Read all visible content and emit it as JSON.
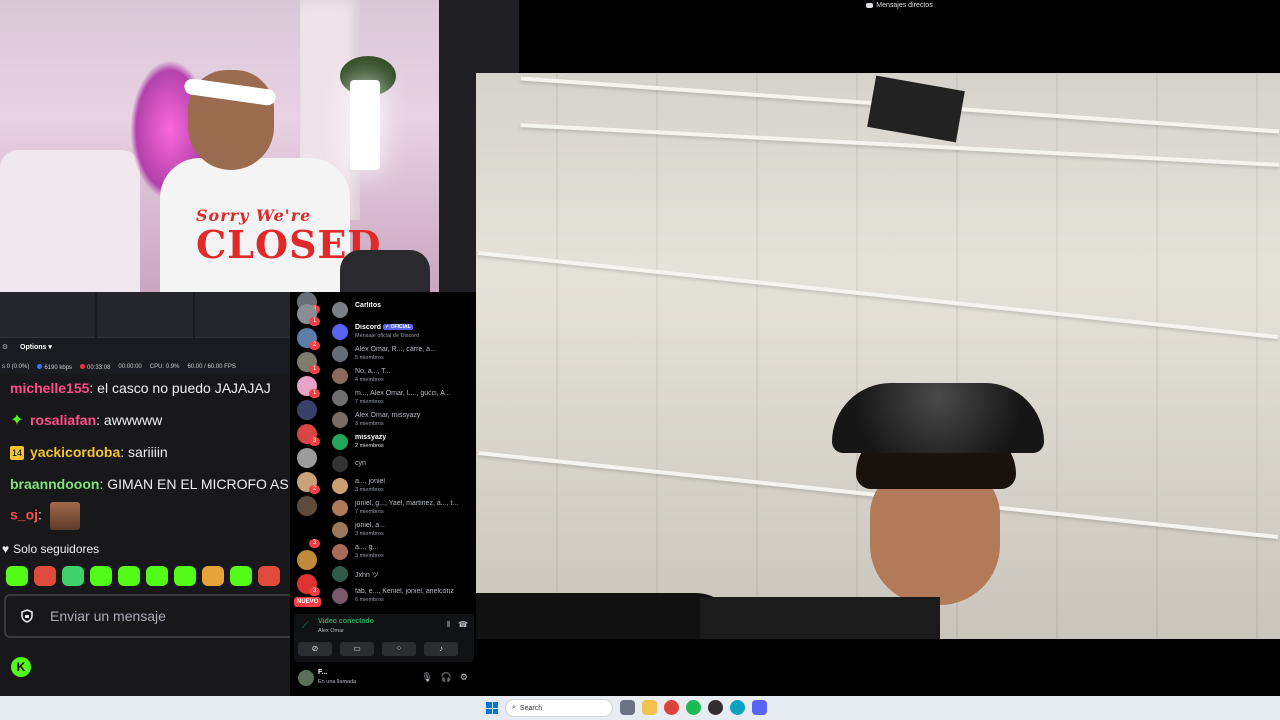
{
  "video_window": {
    "title": "Mensajes directos"
  },
  "webcam": {
    "shirt_line1": "Sorry We're",
    "shirt_line2": "CLOSED"
  },
  "obs": {
    "options_label": "Options",
    "stats": [
      "s 0 (0.0%)",
      "6190 kbps",
      "00:33:08",
      "00:00:00",
      "CPU: 0.9%",
      "60.00 / 60.00 FPS"
    ]
  },
  "chat": {
    "messages": [
      {
        "user": "michelle155",
        "text": "el casco no puedo JAJAJAJ",
        "color": "#ff4f87"
      },
      {
        "user": "rosaliafan",
        "text": "awwwww",
        "color": "#ff4f87",
        "badge": "sparkle"
      },
      {
        "user": "yackicordoba",
        "text": "sariiiin",
        "color": "#f4c430",
        "badge": "14"
      },
      {
        "user": "braanndooon",
        "text": "GIMAN EN EL MICROFO ASI",
        "color": "#7fe27a"
      },
      {
        "user": "s_oj",
        "text": "",
        "color": "#ff4f4f"
      }
    ],
    "followers_only": "Solo seguidores",
    "input_placeholder": "Enviar un mensaje",
    "kick_logo": "K",
    "emote_colors": [
      "#53fc18",
      "#e04a3a",
      "#3fd26b",
      "#53fc18",
      "#53fc18",
      "#53fc18",
      "#53fc18",
      "#e8a23a",
      "#53fc18",
      "#e04a3a"
    ]
  },
  "discord": {
    "guild_badges": [
      "6",
      "1",
      "2",
      "1",
      "1",
      "",
      "3",
      "",
      "2",
      "",
      "3",
      "",
      "3",
      "12",
      "",
      ""
    ],
    "nuevo_label": "NUEVO",
    "dms": [
      {
        "name": "Carlitos",
        "sub": "",
        "bold": true
      },
      {
        "name": "Discord",
        "official": "✓ OFICIAL",
        "sub": "Mensaje oficial de Discord",
        "bold": true
      },
      {
        "name": "Alex Omar, R..., carre, a...",
        "sub": "5 miembros"
      },
      {
        "name": "No, a..., T...",
        "sub": "4 miembros"
      },
      {
        "name": "m..., Alex Omar, L..., gucci, A...",
        "sub": "7 miembros"
      },
      {
        "name": "Alex Omar, missyazy",
        "sub": "3 miembros"
      },
      {
        "name": "missyazy",
        "sub": "2 miembros",
        "bold": true
      },
      {
        "name": "cyn",
        "sub": ""
      },
      {
        "name": "a..., joniel",
        "sub": "3 miembros"
      },
      {
        "name": "joniel, g..., Yael, martinez, a..., t...",
        "sub": "7 miembros"
      },
      {
        "name": "joniel, a...",
        "sub": "3 miembros"
      },
      {
        "name": "a..., g...",
        "sub": "3 miembros"
      },
      {
        "name": "Jxhn ツ",
        "sub": ""
      },
      {
        "name": "fab, e..., Keniel, joniel, arielconz",
        "sub": "6 miembros"
      }
    ],
    "voice": {
      "title": "Video conectado",
      "sub": "Alex Omar"
    },
    "user": {
      "name": "F...",
      "status": "En una llamada"
    }
  },
  "taskbar": {
    "search_placeholder": "Search"
  }
}
